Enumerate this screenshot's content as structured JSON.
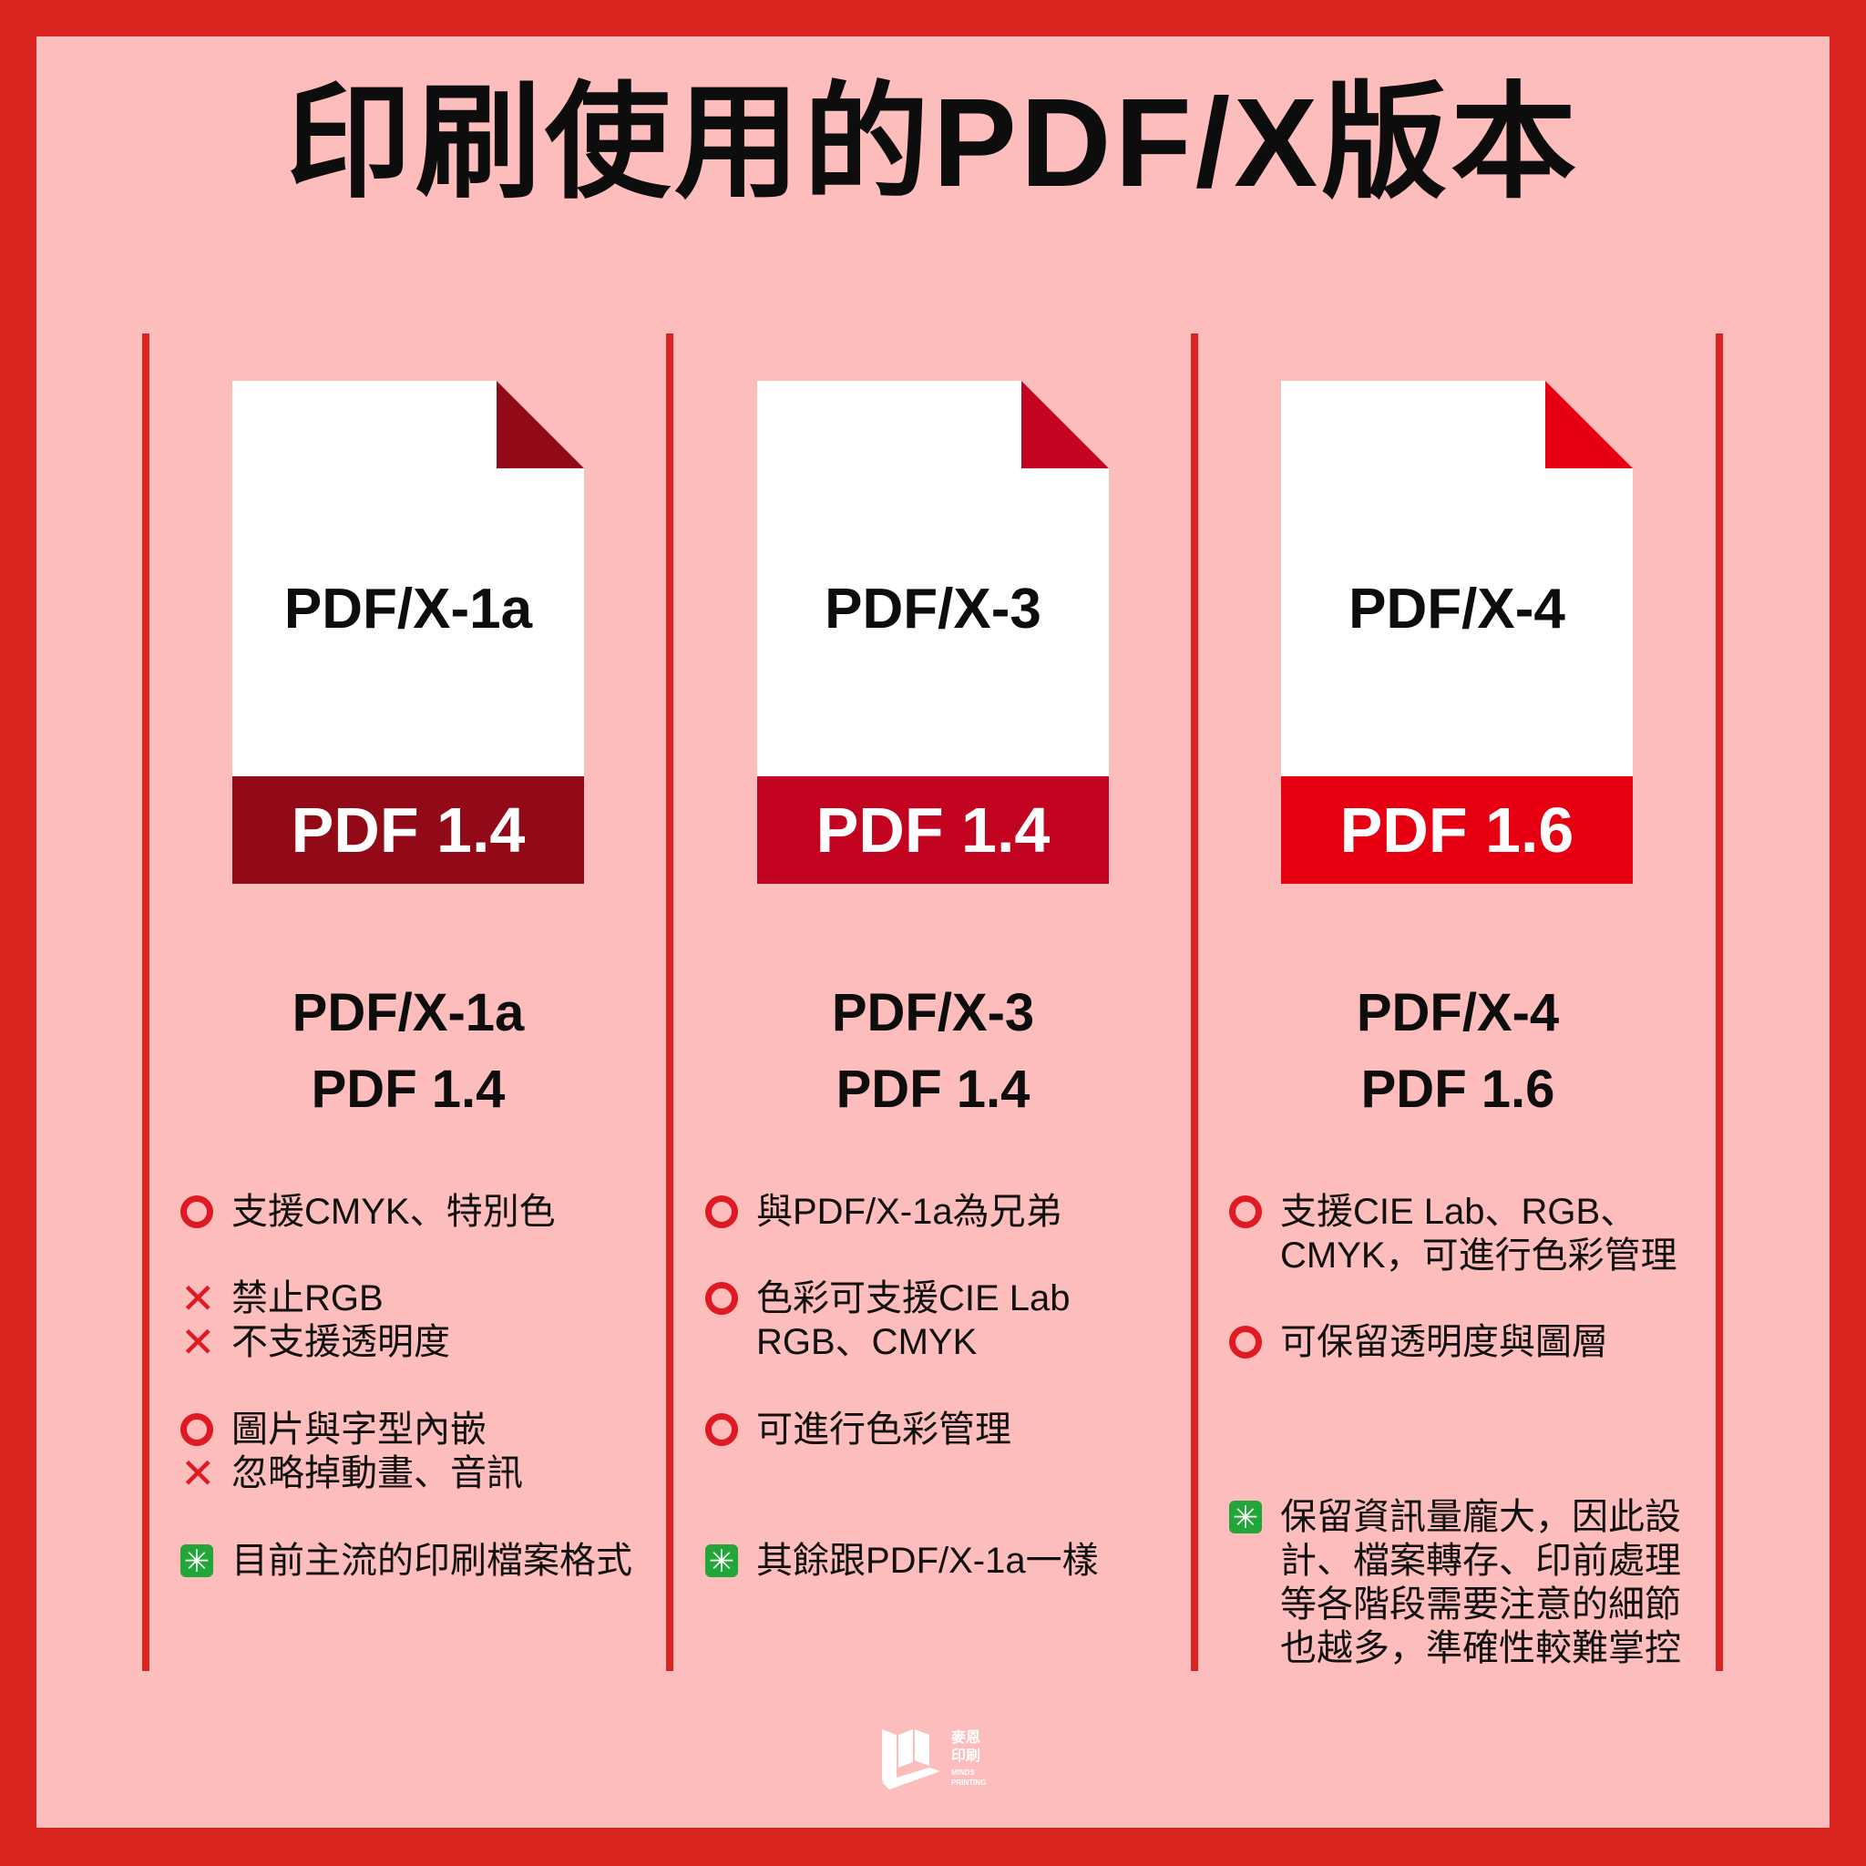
{
  "title": "印刷使用的PDF/X版本",
  "colors": {
    "frame": "#d9241f",
    "background": "#fdbdbc",
    "band_x1a": "#920a18",
    "band_x3": "#c20421",
    "band_x4": "#e60012",
    "ok_icon": "#e01a22",
    "note_icon": "#22a63a"
  },
  "columns": [
    {
      "doc_name": "PDF/X-1a",
      "doc_version": "PDF 1.4",
      "summary_name": "PDF/X-1a",
      "summary_version": "PDF 1.4",
      "features": [
        {
          "icon": "circle-icon",
          "text": "支援CMYK、特別色"
        },
        {
          "icon": "cross-icon",
          "text": "禁止RGB"
        },
        {
          "icon": "cross-icon",
          "text": "不支援透明度"
        },
        {
          "icon": "circle-icon",
          "text": "圖片與字型內嵌"
        },
        {
          "icon": "cross-icon",
          "text": "忽略掉動畫、音訊"
        },
        {
          "icon": "sparkle-icon",
          "text": "目前主流的印刷檔案格式"
        }
      ]
    },
    {
      "doc_name": "PDF/X-3",
      "doc_version": "PDF 1.4",
      "summary_name": "PDF/X-3",
      "summary_version": "PDF 1.4",
      "features": [
        {
          "icon": "circle-icon",
          "text": "與PDF/X-1a為兄弟"
        },
        {
          "icon": "circle-icon",
          "text": "色彩可支援CIE Lab",
          "text2": "RGB、CMYK"
        },
        {
          "icon": "circle-icon",
          "text": "可進行色彩管理"
        },
        {
          "icon": "sparkle-icon",
          "text": "其餘跟PDF/X-1a一樣"
        }
      ]
    },
    {
      "doc_name": "PDF/X-4",
      "doc_version": "PDF 1.6",
      "summary_name": "PDF/X-4",
      "summary_version": "PDF 1.6",
      "features": [
        {
          "icon": "circle-icon",
          "text": "支援CIE Lab、RGB、",
          "text2": "CMYK，可進行色彩管理"
        },
        {
          "icon": "circle-icon",
          "text": "可保留透明度與圖層"
        },
        {
          "icon": "sparkle-icon",
          "text": "保留資訊量龐大，因此設",
          "text2": "計、檔案轉存、印前處理",
          "text3": "等各階段需要注意的細節",
          "text4": "也越多，準確性較難掌控"
        }
      ]
    }
  ],
  "logo": {
    "line1": "麥恩",
    "line2": "印刷",
    "line3": "MINDS",
    "line4": "PRINTING"
  }
}
